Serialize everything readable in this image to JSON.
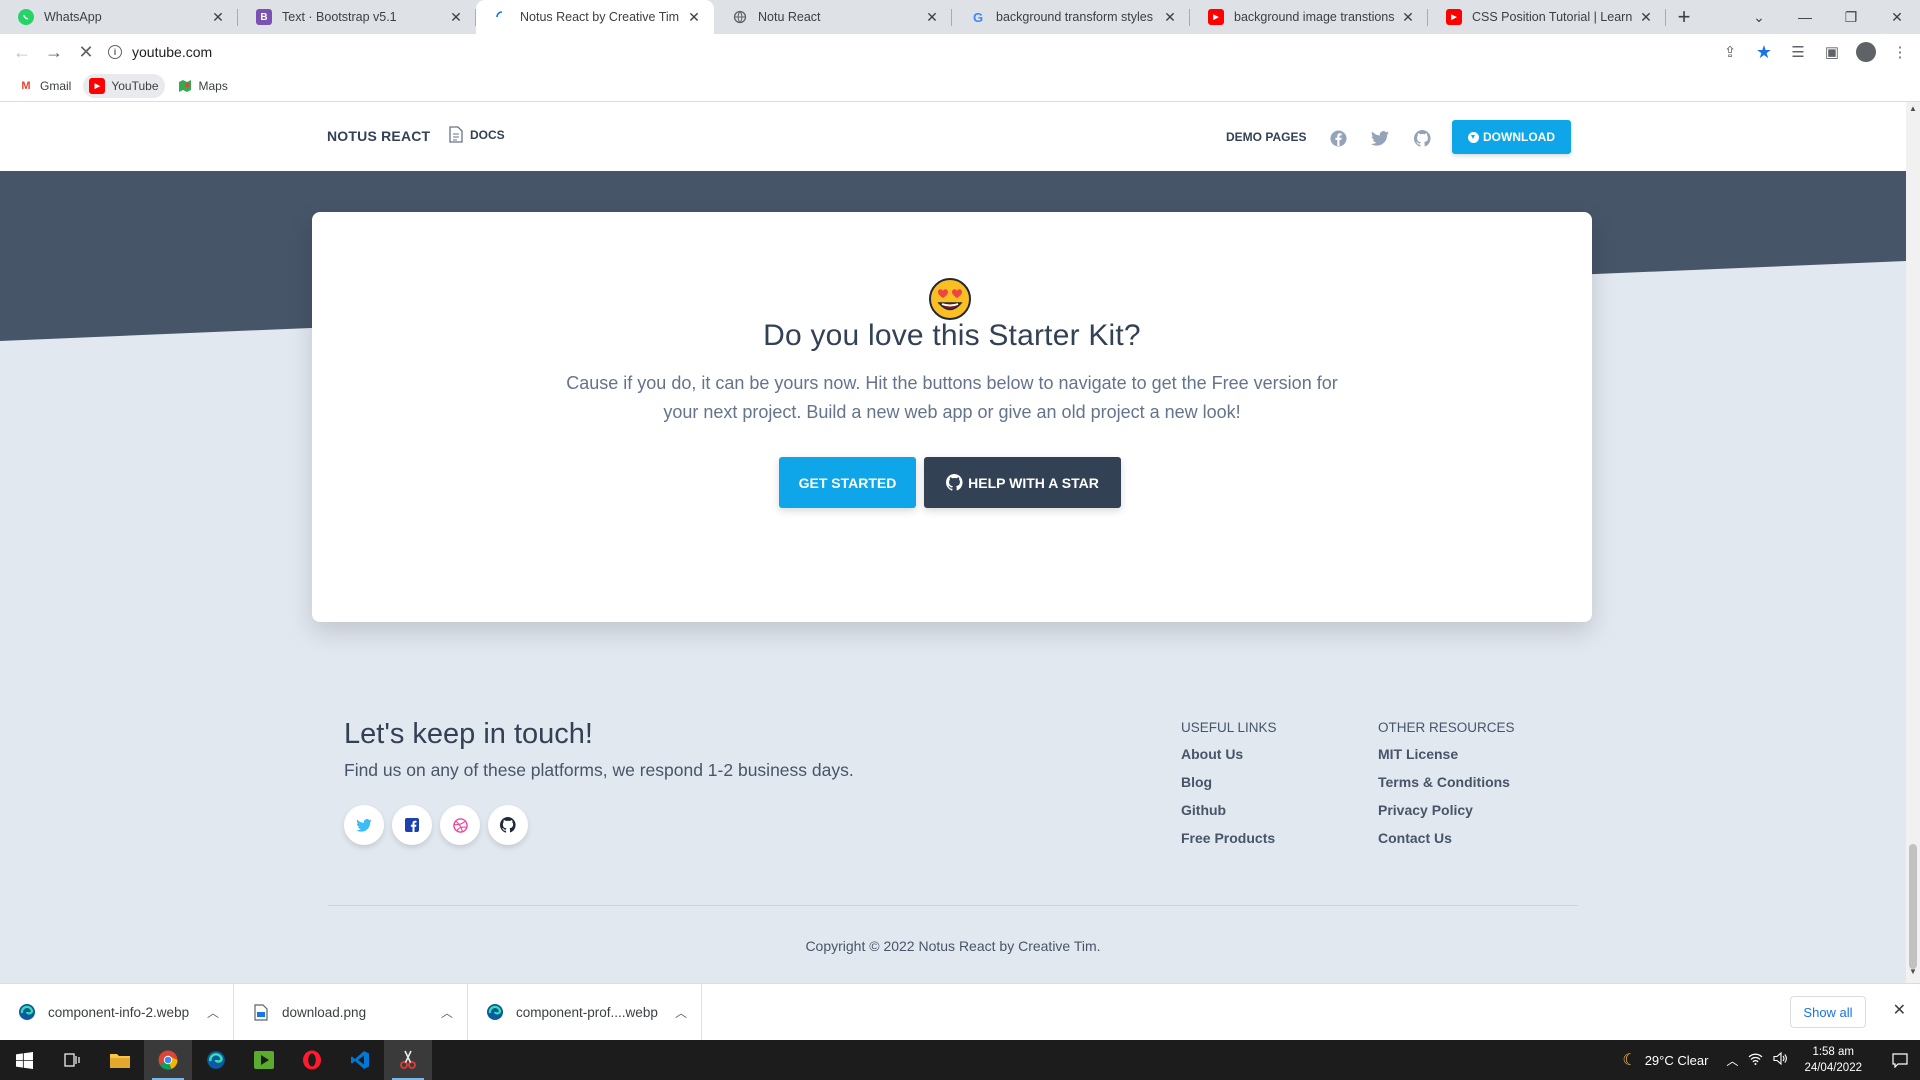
{
  "browser": {
    "tabs": [
      {
        "title": "WhatsApp",
        "favicon": "whatsapp-icon",
        "color": "#25d366",
        "glyph": ""
      },
      {
        "title": "Text · Bootstrap v5.1",
        "favicon": "bootstrap-icon",
        "color": "#7952b3",
        "glyph": "B"
      },
      {
        "title": "Notus React by Creative Tim | Fr",
        "favicon": "loading-icon",
        "color": "#ffffff",
        "glyph": ""
      },
      {
        "title": "Notu React",
        "favicon": "globe-icon",
        "color": "#5f6368",
        "glyph": ""
      },
      {
        "title": "background transform styles bo",
        "favicon": "google-icon",
        "color": "#4285f4",
        "glyph": "G"
      },
      {
        "title": "background image transtions bo",
        "favicon": "youtube-icon",
        "color": "#ff0000",
        "glyph": "▶"
      },
      {
        "title": "CSS Position Tutorial | Learn CSS",
        "favicon": "youtube-icon",
        "color": "#ff0000",
        "glyph": "▶"
      }
    ],
    "url": "youtube.com",
    "bookmarks": [
      {
        "label": "Gmail",
        "icon": "gmail-icon"
      },
      {
        "label": "YouTube",
        "icon": "youtube-icon"
      },
      {
        "label": "Maps",
        "icon": "maps-icon"
      }
    ]
  },
  "navbar": {
    "brand": "NOTUS REACT",
    "docs": "DOCS",
    "demo_pages": "DEMO PAGES",
    "download": "DOWNLOAD",
    "social_icons": [
      "facebook-icon",
      "twitter-icon",
      "github-icon"
    ]
  },
  "cta_card": {
    "emoji": "heart-eyes-emoji",
    "title": "Do you love this Starter Kit?",
    "text": "Cause if you do, it can be yours now. Hit the buttons below to navigate to get the Free version for your next project. Build a new web app or give an old project a new look!",
    "primary_button": "GET STARTED",
    "secondary_button": "HELP WITH A STAR"
  },
  "footer": {
    "title": "Let's keep in touch!",
    "subtitle": "Find us on any of these platforms, we respond 1-2 business days.",
    "social_icons": [
      "twitter-icon",
      "facebook-icon",
      "dribbble-icon",
      "github-icon"
    ],
    "useful_links": {
      "heading": "USEFUL LINKS",
      "items": [
        "About Us",
        "Blog",
        "Github",
        "Free Products"
      ]
    },
    "other_resources": {
      "heading": "OTHER RESOURCES",
      "items": [
        "MIT License",
        "Terms & Conditions",
        "Privacy Policy",
        "Contact Us"
      ]
    },
    "copyright": "Copyright © 2022 Notus React by Creative Tim."
  },
  "downloads": {
    "items": [
      {
        "name": "component-info-2.webp",
        "icon": "edge-icon"
      },
      {
        "name": "download.png",
        "icon": "image-file-icon"
      },
      {
        "name": "component-prof....webp",
        "icon": "edge-icon"
      }
    ],
    "show_all": "Show all"
  },
  "taskbar": {
    "weather": "29°C  Clear",
    "time": "1:58 am",
    "date": "24/04/2022"
  },
  "colors": {
    "accent": "#0ea5e9",
    "dark": "#334155",
    "hero": "#475569",
    "page_bg": "#e2e8f0"
  }
}
